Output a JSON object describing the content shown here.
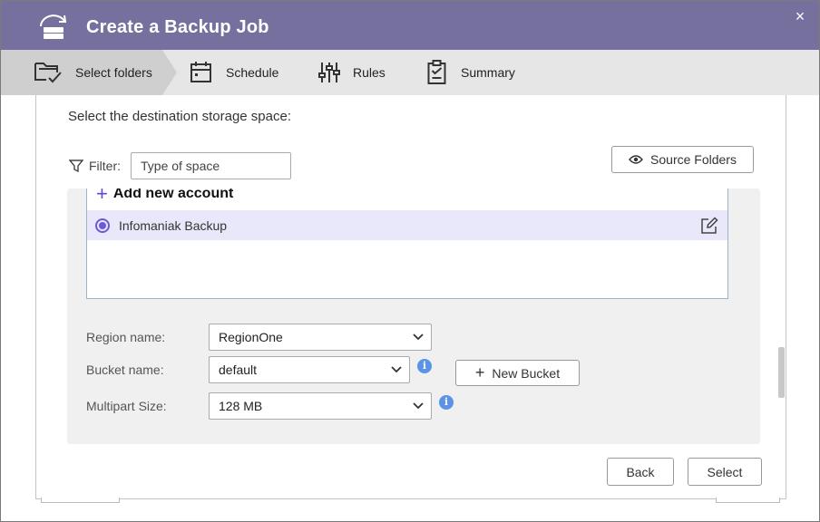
{
  "dialog": {
    "title": "Create a Backup Job",
    "close_symbol": "×"
  },
  "steps": [
    {
      "label": "Select folders",
      "icon": "folder-check-icon",
      "active": true
    },
    {
      "label": "Schedule",
      "icon": "calendar-icon",
      "active": false
    },
    {
      "label": "Rules",
      "icon": "sliders-icon",
      "active": false
    },
    {
      "label": "Summary",
      "icon": "clipboard-check-icon",
      "active": false
    }
  ],
  "destination": {
    "prompt": "Select the destination storage space:",
    "filter_label": "Filter:",
    "filter_placeholder": "Type of space",
    "source_folders_label": "Source Folders",
    "add_account_label": "Add new account",
    "accounts": [
      {
        "name": "Infomaniak Backup",
        "selected": true
      }
    ]
  },
  "settings": {
    "region_label": "Region name:",
    "region_value": "RegionOne",
    "bucket_label": "Bucket name:",
    "bucket_value": "default",
    "new_bucket_label": "New Bucket",
    "multipart_label": "Multipart Size:",
    "multipart_value": "128 MB",
    "info_symbol": "i"
  },
  "footer": {
    "back_label": "Back",
    "select_label": "Select"
  },
  "colors": {
    "titlebar": "#76709e",
    "accent": "#6a5ad6",
    "selected_row": "#e9e8fa",
    "info": "#5b93e6"
  }
}
